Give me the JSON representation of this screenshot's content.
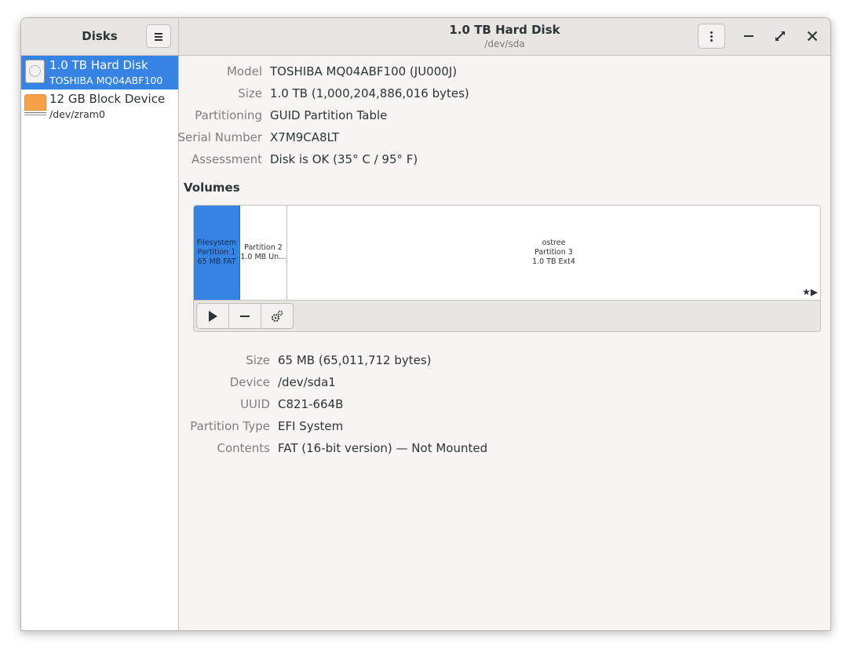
{
  "sidebar": {
    "title": "Disks",
    "menu_icon": "hamburger-icon",
    "devices": [
      {
        "name": "1.0 TB Hard Disk",
        "sub": "TOSHIBA MQ04ABF100",
        "icon": "hard-disk-icon",
        "selected": true
      },
      {
        "name": "12 GB Block Device",
        "sub": "/dev/zram0",
        "icon": "block-device-icon",
        "selected": false
      }
    ]
  },
  "header": {
    "title": "1.0 TB Hard Disk",
    "subtitle": "/dev/sda",
    "menu_icon": "kebab-menu-icon",
    "window_controls": [
      "minimize-icon",
      "maximize-icon",
      "close-icon"
    ]
  },
  "disk_info": [
    {
      "label": "Model",
      "value": "TOSHIBA MQ04ABF100 (JU000J)"
    },
    {
      "label": "Size",
      "value": "1.0 TB (1,000,204,886,016 bytes)"
    },
    {
      "label": "Partitioning",
      "value": "GUID Partition Table"
    },
    {
      "label": "Serial Number",
      "value": "X7M9CA8LT"
    },
    {
      "label": "Assessment",
      "value": "Disk is OK (35° C / 95° F)"
    }
  ],
  "volumes": {
    "heading": "Volumes",
    "partitions": [
      {
        "lines": [
          "Filesystem",
          "Partition 1",
          "65 MB FAT"
        ],
        "selected": true
      },
      {
        "lines": [
          "Partition 2",
          "1.0 MB Un…"
        ],
        "selected": false
      },
      {
        "lines": [
          "ostree",
          "Partition 3",
          "1.0 TB Ext4"
        ],
        "selected": false
      }
    ],
    "marks": "★▶",
    "toolbar": [
      "play-icon",
      "minus-icon",
      "gears-icon"
    ]
  },
  "partition_info": [
    {
      "label": "Size",
      "value": "65 MB (65,011,712 bytes)"
    },
    {
      "label": "Device",
      "value": "/dev/sda1"
    },
    {
      "label": "UUID",
      "value": "C821-664B"
    },
    {
      "label": "Partition Type",
      "value": "EFI System"
    },
    {
      "label": "Contents",
      "value": "FAT (16-bit version) — Not Mounted"
    }
  ],
  "colors": {
    "accent": "#3584e4",
    "block_device": "#f6a04a"
  }
}
